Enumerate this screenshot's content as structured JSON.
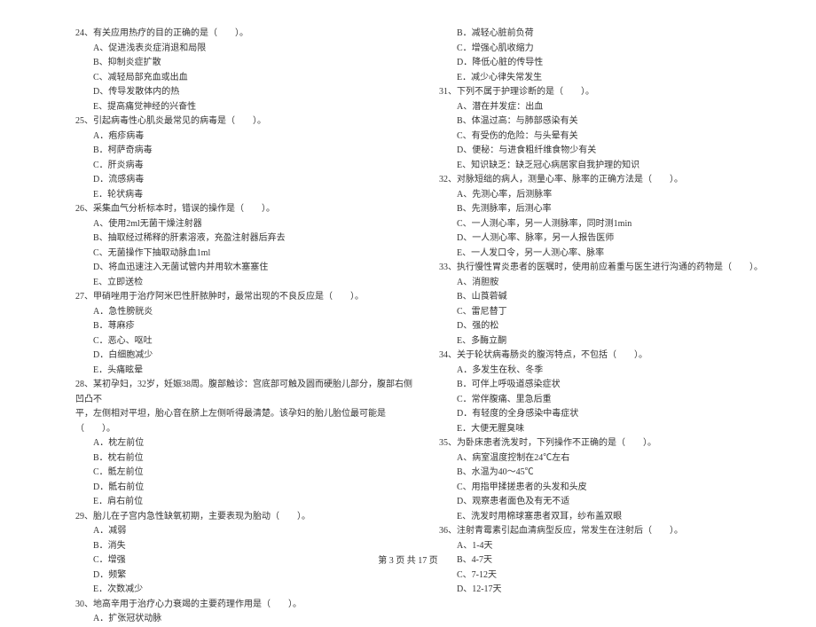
{
  "footer": "第 3 页 共 17 页",
  "left": [
    {
      "t": "stem",
      "v": "24、有关应用热疗的目的正确的是（　　）。"
    },
    {
      "t": "opt",
      "v": "A、促进浅表炎症消退和局限"
    },
    {
      "t": "opt",
      "v": "B、抑制炎症扩散"
    },
    {
      "t": "opt",
      "v": "C、减轻局部充血或出血"
    },
    {
      "t": "opt",
      "v": "D、传导发散体内的热"
    },
    {
      "t": "opt",
      "v": "E、提高痛觉神经的兴奋性"
    },
    {
      "t": "stem",
      "v": "25、引起病毒性心肌炎最常见的病毒是（　　）。"
    },
    {
      "t": "opt",
      "v": "A．疱疹病毒"
    },
    {
      "t": "opt",
      "v": "B．柯萨奇病毒"
    },
    {
      "t": "opt",
      "v": "C．肝炎病毒"
    },
    {
      "t": "opt",
      "v": "D．流感病毒"
    },
    {
      "t": "opt",
      "v": "E．轮状病毒"
    },
    {
      "t": "stem",
      "v": "26、采集血气分析标本时，错误的操作是（　　）。"
    },
    {
      "t": "opt",
      "v": "A、使用2ml无菌干燥注射器"
    },
    {
      "t": "opt",
      "v": "B、抽取经过稀释的肝素溶液，充盈注射器后弃去"
    },
    {
      "t": "opt",
      "v": "C、无菌操作下抽取动脉血1ml"
    },
    {
      "t": "opt",
      "v": "D、将血迅速注入无菌试管内并用软木塞塞住"
    },
    {
      "t": "opt",
      "v": "E、立即送检"
    },
    {
      "t": "stem",
      "v": "27、甲硝唑用于治疗阿米巴性肝脓肿时，最常出现的不良反应是（　　）。"
    },
    {
      "t": "opt",
      "v": "A．急性膀胱炎"
    },
    {
      "t": "opt",
      "v": "B．荨麻疹"
    },
    {
      "t": "opt",
      "v": "C．恶心、呕吐"
    },
    {
      "t": "opt",
      "v": "D．白细胞减少"
    },
    {
      "t": "opt",
      "v": "E．头痛眩晕"
    },
    {
      "t": "stem",
      "v": "28、某初孕妇，32岁，妊娠38周。腹部触诊：宫底部可触及圆而硬胎儿部分，腹部右侧凹凸不"
    },
    {
      "t": "stem",
      "v": "平，左侧相对平坦，胎心音在脐上左侧听得最清楚。该孕妇的胎儿胎位最可能是（　　）。"
    },
    {
      "t": "opt",
      "v": "A．枕左前位"
    },
    {
      "t": "opt",
      "v": "B．枕右前位"
    },
    {
      "t": "opt",
      "v": "C．骶左前位"
    },
    {
      "t": "opt",
      "v": "D．骶右前位"
    },
    {
      "t": "opt",
      "v": "E．肩右前位"
    },
    {
      "t": "stem",
      "v": "29、胎儿在子宫内急性缺氧初期，主要表现为胎动（　　）。"
    },
    {
      "t": "opt",
      "v": "A．减弱"
    },
    {
      "t": "opt",
      "v": "B．消失"
    },
    {
      "t": "opt",
      "v": "C．增强"
    },
    {
      "t": "opt",
      "v": "D．频繁"
    },
    {
      "t": "opt",
      "v": "E．次数减少"
    },
    {
      "t": "stem",
      "v": "30、地高辛用于治疗心力衰竭的主要药理作用是（　　）。"
    },
    {
      "t": "opt",
      "v": "A．扩张冠状动脉"
    }
  ],
  "right": [
    {
      "t": "opt",
      "v": "B．减轻心脏前负荷"
    },
    {
      "t": "opt",
      "v": "C．增强心肌收缩力"
    },
    {
      "t": "opt",
      "v": "D．降低心脏的传导性"
    },
    {
      "t": "opt",
      "v": "E．减少心律失常发生"
    },
    {
      "t": "stem",
      "v": "31、下列不属于护理诊断的是（　　）。"
    },
    {
      "t": "opt",
      "v": "A、潜在并发症：出血"
    },
    {
      "t": "opt",
      "v": "B、体温过高：与肺部感染有关"
    },
    {
      "t": "opt",
      "v": "C、有受伤的危险：与头晕有关"
    },
    {
      "t": "opt",
      "v": "D、便秘：与进食粗纤维食物少有关"
    },
    {
      "t": "opt",
      "v": "E、知识缺乏：缺乏冠心病居家自我护理的知识"
    },
    {
      "t": "stem",
      "v": "32、对脉短绌的病人，测量心率、脉率的正确方法是（　　）。"
    },
    {
      "t": "opt",
      "v": "A、先测心率，后测脉率"
    },
    {
      "t": "opt",
      "v": "B、先测脉率，后测心率"
    },
    {
      "t": "opt",
      "v": "C、一人测心率，另一人测脉率，同时测1min"
    },
    {
      "t": "opt",
      "v": "D、一人测心率、脉率，另一人报告医师"
    },
    {
      "t": "opt",
      "v": "E、一人发口令，另一人测心率、脉率"
    },
    {
      "t": "stem",
      "v": "33、执行慢性胃炎患者的医嘱时，使用前应着重与医生进行沟通的药物是（　　）。"
    },
    {
      "t": "opt",
      "v": "A、消胆胺"
    },
    {
      "t": "opt",
      "v": "B、山莨菪碱"
    },
    {
      "t": "opt",
      "v": "C、雷尼替丁"
    },
    {
      "t": "opt",
      "v": "D、强的松"
    },
    {
      "t": "opt",
      "v": "E、多酶立酮"
    },
    {
      "t": "stem",
      "v": "34、关于轮状病毒肠炎的腹泻特点，不包括（　　）。"
    },
    {
      "t": "opt",
      "v": "A．多发生在秋、冬季"
    },
    {
      "t": "opt",
      "v": "B．可伴上呼吸道感染症状"
    },
    {
      "t": "opt",
      "v": "C．常伴腹痛、里急后重"
    },
    {
      "t": "opt",
      "v": "D．有轻度的全身感染中毒症状"
    },
    {
      "t": "opt",
      "v": "E．大便无腥臭味"
    },
    {
      "t": "stem",
      "v": "35、为卧床患者洗发时，下列操作不正确的是（　　）。"
    },
    {
      "t": "opt",
      "v": "A、病室温度控制在24℃左右"
    },
    {
      "t": "opt",
      "v": "B、水温为40～45℃"
    },
    {
      "t": "opt",
      "v": "C、用指甲揉搓患者的头发和头皮"
    },
    {
      "t": "opt",
      "v": "D、观察患者面色及有无不适"
    },
    {
      "t": "opt",
      "v": "E、洗发时用棉球塞患者双耳，纱布盖双眼"
    },
    {
      "t": "stem",
      "v": "36、注射青霉素引起血清病型反应，常发生在注射后（　　）。"
    },
    {
      "t": "opt",
      "v": "A、1-4天"
    },
    {
      "t": "opt",
      "v": "B、4-7天"
    },
    {
      "t": "opt",
      "v": "C、7-12天"
    },
    {
      "t": "opt",
      "v": "D、12-17天"
    }
  ]
}
